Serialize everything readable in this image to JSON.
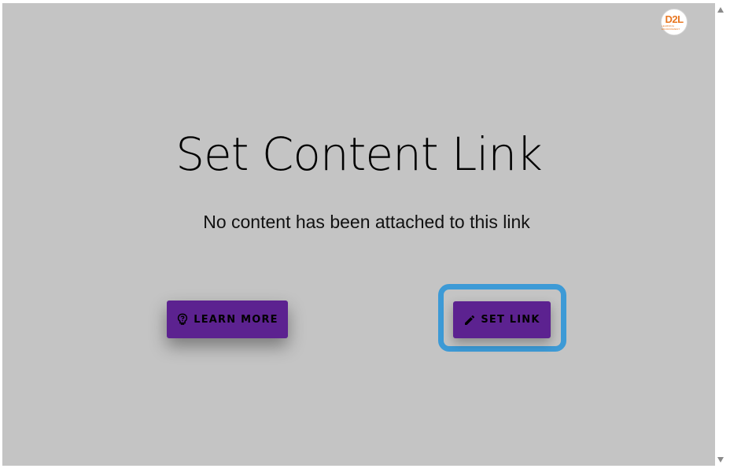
{
  "logo": {
    "mark": "D2L",
    "sub": "LEARNING ENVIRONMENT"
  },
  "heading": "Set Content Link",
  "message": "No content has been attached to this link",
  "buttons": {
    "learn_more": {
      "label": "LEARN MORE",
      "icon": "lightbulb-question-icon"
    },
    "set_link": {
      "label": "SET LINK",
      "icon": "pencil-icon"
    }
  },
  "colors": {
    "background": "#c4c4c4",
    "button": "#5c2290",
    "focus_ring": "#3d9ad6",
    "logo_accent": "#e87722"
  }
}
